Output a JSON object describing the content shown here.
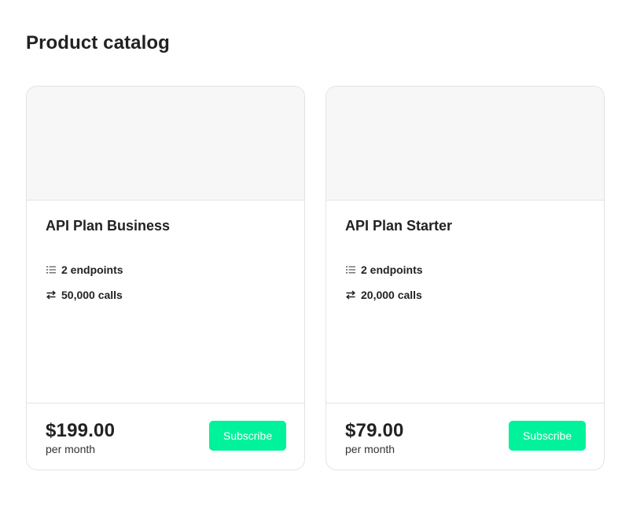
{
  "page": {
    "title": "Product catalog"
  },
  "colors": {
    "accent": "#00f29a",
    "border": "#e3e3e3",
    "image_placeholder": "#f7f7f7",
    "text": "#222222"
  },
  "products": [
    {
      "name": "API Plan Business",
      "features": [
        {
          "icon": "list-icon",
          "text": "2 endpoints"
        },
        {
          "icon": "swap-arrows-icon",
          "text": "50,000 calls"
        }
      ],
      "price": "$199.00",
      "period": "per month",
      "button_label": "Subscribe"
    },
    {
      "name": "API Plan Starter",
      "features": [
        {
          "icon": "list-icon",
          "text": "2 endpoints"
        },
        {
          "icon": "swap-arrows-icon",
          "text": "20,000 calls"
        }
      ],
      "price": "$79.00",
      "period": "per month",
      "button_label": "Subscribe"
    }
  ]
}
